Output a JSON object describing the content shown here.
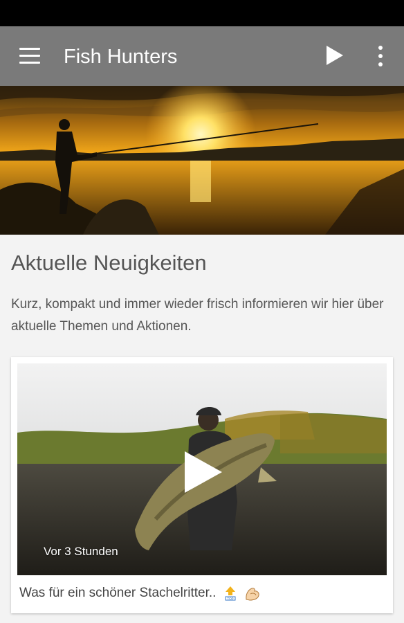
{
  "app": {
    "title": "Fish Hunters"
  },
  "toolbar": {
    "menu_icon": "hamburger-menu-icon",
    "play_icon": "play-icon",
    "more_icon": "overflow-menu-icon",
    "background_color": "#7a7a7a"
  },
  "news": {
    "heading": "Aktuelle Neuigkeiten",
    "intro": "Kurz, kompakt und immer wieder frisch informieren wir hier über aktuelle Themen und Aktionen."
  },
  "post": {
    "time_ago": "Vor 3 Stunden",
    "caption": "Was für ein schöner Stachelritter..",
    "emoji_icons": [
      "top-arrow-icon",
      "flexed-biceps-icon"
    ]
  }
}
